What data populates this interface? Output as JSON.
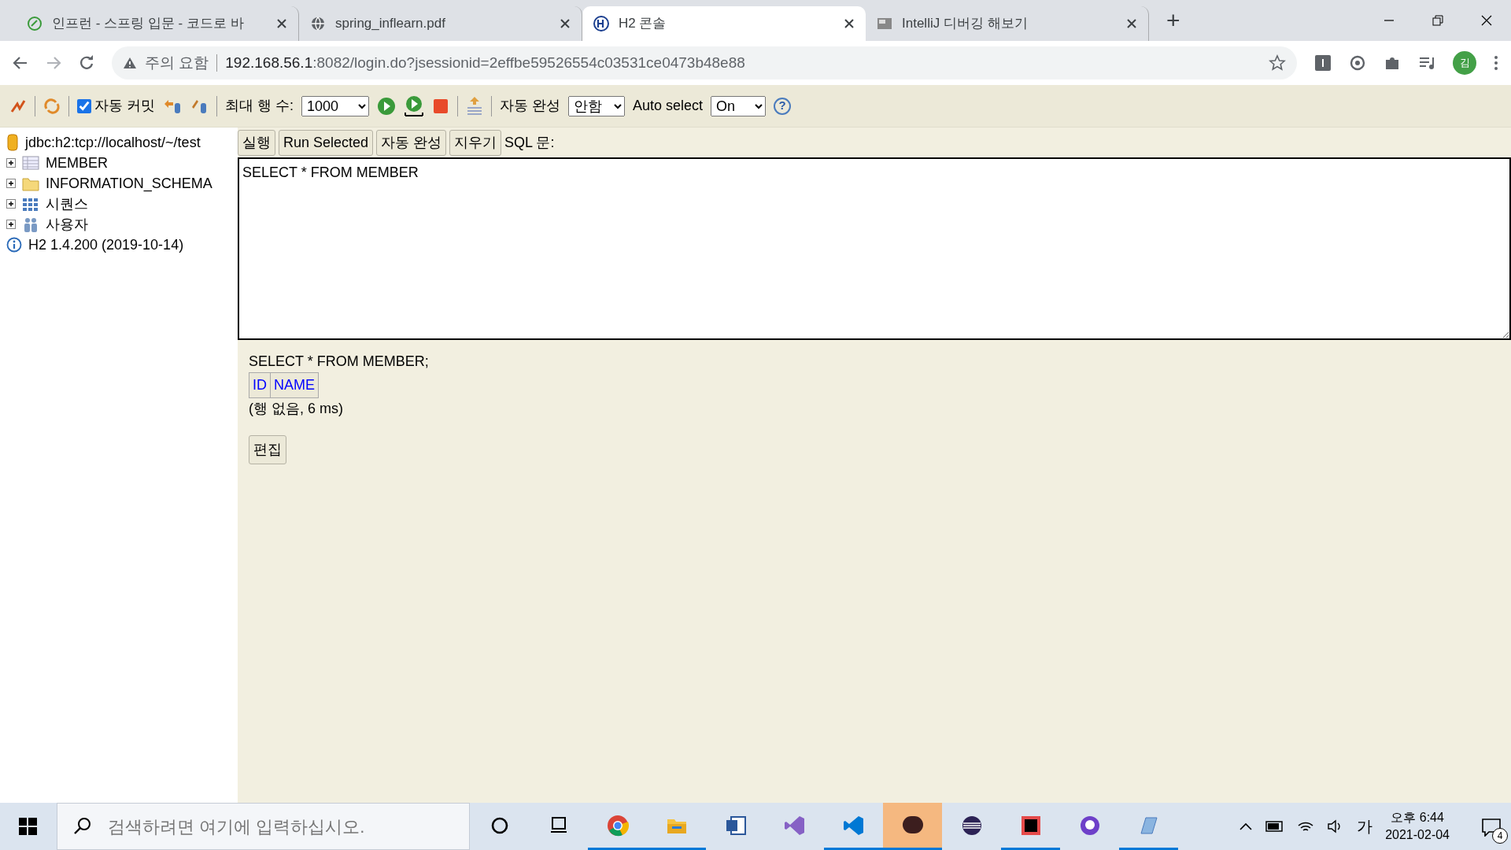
{
  "browser": {
    "tabs": [
      {
        "title": "인프런 - 스프링 입문 - 코드로 바",
        "kind": "leaf",
        "selected": false
      },
      {
        "title": "spring_inflearn.pdf",
        "kind": "globe",
        "selected": false
      },
      {
        "title": "H2 콘솔",
        "kind": "h2",
        "selected": true
      },
      {
        "title": "IntelliJ 디버깅 해보기",
        "kind": "thumb",
        "selected": false
      }
    ],
    "new_tab": "+",
    "warning": "주의 요함",
    "url_host": "192.168.56.1",
    "url_rest": ":8082/login.do?jsessionid=2effbe59526554c03531ce0473b48e88",
    "profile": "김"
  },
  "toolbar": {
    "autocommit": {
      "label": "자동 커밋",
      "checked": true
    },
    "max_rows": {
      "label": "최대 행 수:",
      "value": "1000"
    },
    "autocomplete": {
      "label": "자동 완성",
      "value": "안함"
    },
    "auto_select": {
      "label": "Auto select",
      "value": "On"
    },
    "help": "?"
  },
  "tree": {
    "connection": "jdbc:h2:tcp://localhost/~/test",
    "items": [
      {
        "label": "MEMBER",
        "kind": "table",
        "expanded": false
      },
      {
        "label": "INFORMATION_SCHEMA",
        "kind": "folder",
        "expanded": false
      },
      {
        "label": "시퀀스",
        "kind": "sequence",
        "expanded": false
      },
      {
        "label": "사용자",
        "kind": "users",
        "expanded": false
      }
    ],
    "version": "H2 1.4.200 (2019-10-14)"
  },
  "query": {
    "buttons": [
      "실행",
      "Run Selected",
      "자동 완성",
      "지우기"
    ],
    "sql_label": "SQL 문:",
    "sql": "SELECT * FROM MEMBER"
  },
  "result": {
    "statement": "SELECT * FROM MEMBER;",
    "columns": [
      "ID",
      "NAME"
    ],
    "summary": "(행 없음, 6 ms)",
    "edit_button": "편집"
  },
  "taskbar": {
    "search_placeholder": "검색하려면 여기에 입력하십시오.",
    "apps": [
      {
        "kind": "cortana",
        "running": false
      },
      {
        "kind": "taskview",
        "running": false
      },
      {
        "kind": "chrome",
        "running": true
      },
      {
        "kind": "explorer",
        "running": true
      },
      {
        "kind": "word",
        "running": false
      },
      {
        "kind": "vs",
        "running": false
      },
      {
        "kind": "vscode",
        "running": true
      },
      {
        "kind": "talk",
        "running": true
      },
      {
        "kind": "eclipse",
        "running": false
      },
      {
        "kind": "intellij",
        "running": true
      },
      {
        "kind": "github",
        "running": false
      },
      {
        "kind": "notepad",
        "running": true
      }
    ],
    "ime": "가",
    "time": "오후 6:44",
    "date": "2021-02-04",
    "notifications": "4"
  }
}
